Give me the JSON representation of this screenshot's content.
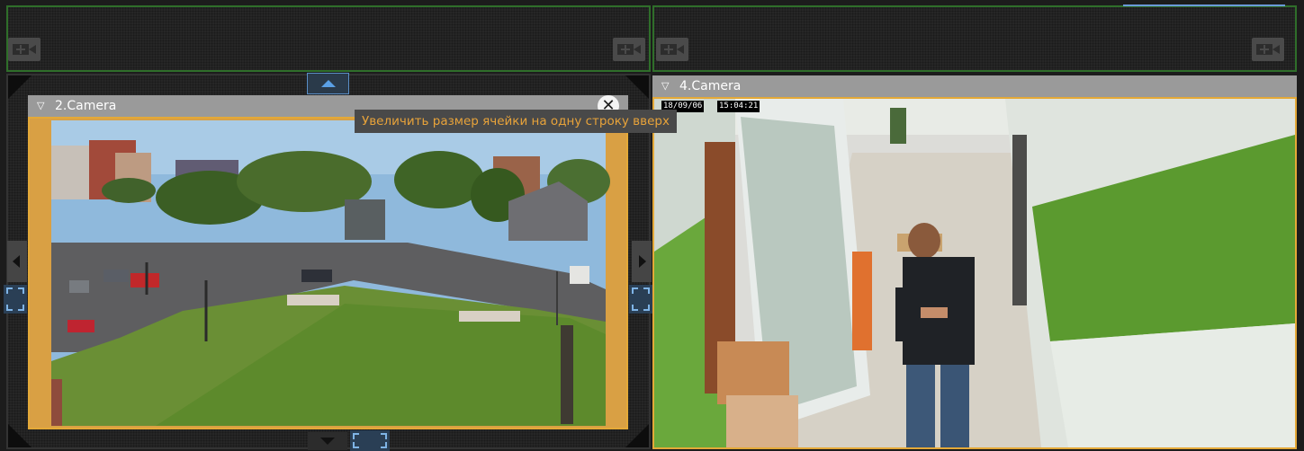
{
  "layout_slots": [
    {
      "name": "empty-slot-top-left",
      "icon": "add-camera-icon"
    },
    {
      "name": "empty-slot-top-right",
      "icon": "add-camera-icon"
    }
  ],
  "cameras": {
    "camera2": {
      "title": "2.Camera",
      "menu_icon": "▽",
      "close_icon": "✕"
    },
    "camera4": {
      "title": "4.Camera",
      "menu_icon": "▽",
      "date": "18/09/06",
      "time": "15:04:21"
    }
  },
  "tooltip": {
    "text": "Увеличить размер ячейки на одну строку вверх"
  },
  "colors": {
    "selection_border": "#e4a938",
    "slot_border": "#2f6e2a",
    "edit_handle": "#5aa0e6",
    "tooltip_text": "#e8a33a"
  }
}
